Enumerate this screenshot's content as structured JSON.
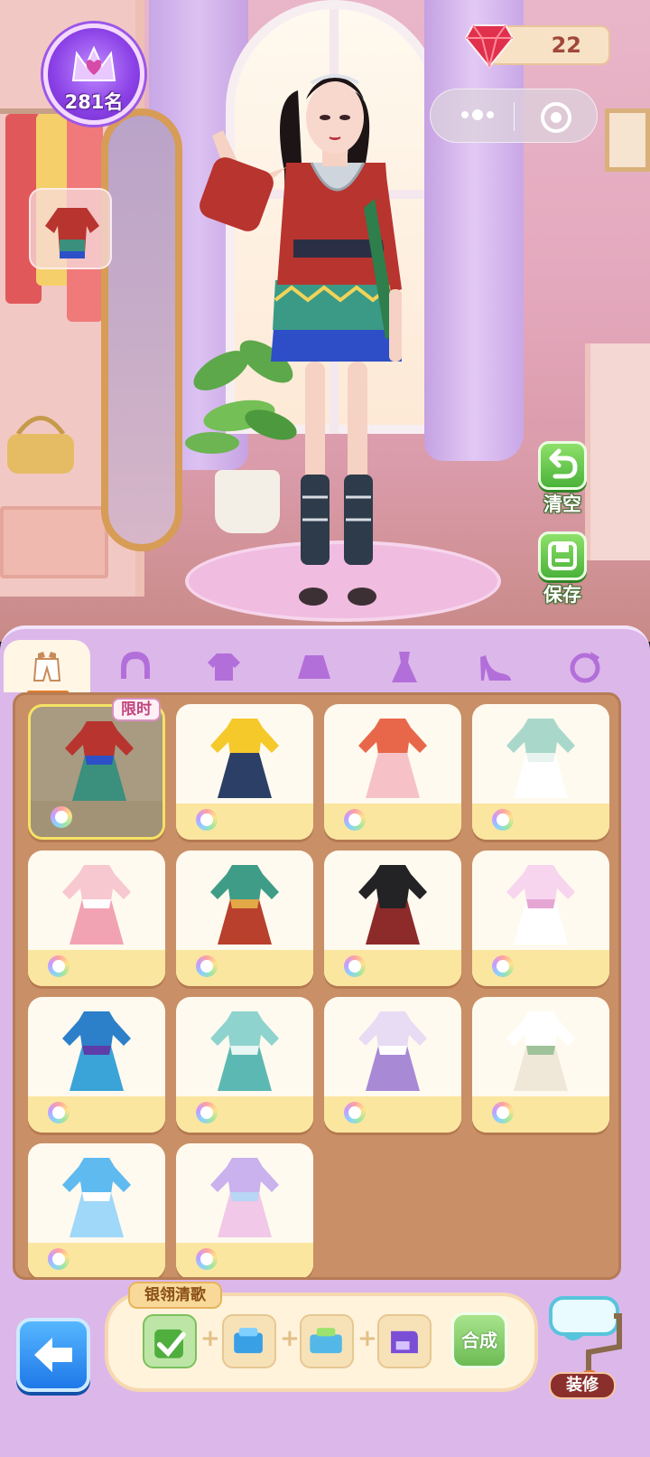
{
  "hud": {
    "rank": "281名",
    "gems": "22"
  },
  "side_actions": {
    "clear_label": "清空",
    "save_label": "保存"
  },
  "tabs": [
    "outfit-suit",
    "hair",
    "top",
    "skirt",
    "dress",
    "shoes",
    "accessory"
  ],
  "grid": {
    "limited_tag": "限时",
    "items": [
      {
        "kind": "ethnic-red",
        "colors": [
          "#b8342e",
          "#3a8f7d",
          "#2d50c9"
        ]
      },
      {
        "kind": "overalls",
        "colors": [
          "#f6c92a",
          "#2c3f66",
          "#2c3f66"
        ]
      },
      {
        "kind": "jacket-skirt",
        "colors": [
          "#e8674a",
          "#f6c2c8",
          "#f6c2c8"
        ]
      },
      {
        "kind": "qipao",
        "colors": [
          "#a9d8cb",
          "#ffffff",
          "#e8f2ee"
        ]
      },
      {
        "kind": "pink-gown",
        "colors": [
          "#f7c8cf",
          "#f2a3b3",
          "#ffffff"
        ]
      },
      {
        "kind": "han-red",
        "colors": [
          "#3f9c87",
          "#b8402c",
          "#e2a846"
        ]
      },
      {
        "kind": "black-robe",
        "colors": [
          "#232326",
          "#8d2a2a",
          "#232326"
        ]
      },
      {
        "kind": "pink-romper",
        "colors": [
          "#f7d5ef",
          "#ffffff",
          "#e6a6d4"
        ]
      },
      {
        "kind": "blue-ethnic",
        "colors": [
          "#2c80c9",
          "#3aa3d8",
          "#5d3da8"
        ]
      },
      {
        "kind": "teal-hanfu",
        "colors": [
          "#8fd3ce",
          "#5cb8b2",
          "#e8f6f4"
        ]
      },
      {
        "kind": "lavender-hanfu",
        "colors": [
          "#e7dcf4",
          "#a889d6",
          "#ffffff"
        ]
      },
      {
        "kind": "white-dress",
        "colors": [
          "#ffffff",
          "#efe8d8",
          "#9fc29a"
        ]
      },
      {
        "kind": "blue-gown",
        "colors": [
          "#5fbaf0",
          "#9fd8f8",
          "#ffffff"
        ]
      },
      {
        "kind": "fairy-gown",
        "colors": [
          "#c9b2ee",
          "#f1c8e8",
          "#b8d6f5"
        ]
      }
    ]
  },
  "synthesis": {
    "title": "银翎清歌",
    "combine_label": "合成"
  },
  "decorate_label": "装修",
  "colors": {
    "panel_bg": "#dcb7ea",
    "grid_bg": "#c98f66",
    "accent_green": "#4bb33a",
    "accent_blue": "#1e78e8"
  }
}
